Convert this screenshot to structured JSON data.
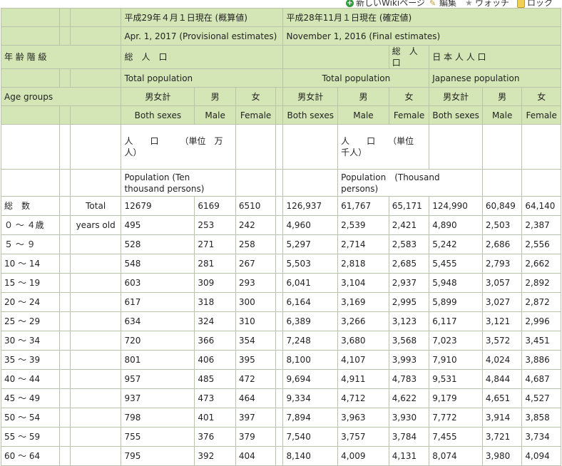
{
  "toolbar": {
    "new_wiki": "新しいWikiページ",
    "edit": "編集",
    "watch": "ウォッチ",
    "lock": "ロック"
  },
  "header": {
    "date_2017_jp": "平成29年４月１日現在 (概算値)",
    "date_2016_jp": "平成28年11月１日現在 (確定値)",
    "date_2017_en": "Apr. 1, 2017 (Provisional estimates)",
    "date_2016_en": "November 1, 2016 (Final estimates)",
    "age_jp": "年 齢 階 級",
    "total_pop_jp": "総　人　口",
    "japanese_pop_jp": "日 本 人 人 口",
    "total_pop_en": "Total population",
    "japanese_pop_en": "Japanese population",
    "age_en": "Age groups",
    "both_jp": "男女計",
    "male_jp": "男",
    "female_jp": "女",
    "both_en": "Both sexes",
    "male_en": "Male",
    "female_en": "Female",
    "unit_2017_jp": "人　　口　　　（単位　万人）",
    "unit_2016_jp": "人　　口　　（単位　千人）",
    "unit_2017_en": "Population (Ten thousand persons)",
    "unit_2016_en": "Population　(Thousand persons)"
  },
  "rows": [
    {
      "age": "総　数",
      "age_en": "Total",
      "v": [
        "12679",
        "6169",
        "6510",
        "126,937",
        "61,767",
        "65,171",
        "124,990",
        "60,849",
        "64,140"
      ]
    },
    {
      "age": "０ ～ ４歳",
      "age_en": "years old",
      "v": [
        "495",
        "253",
        "242",
        "4,960",
        "2,539",
        "2,421",
        "4,890",
        "2,503",
        "2,387"
      ]
    },
    {
      "age": "５ ～ ９",
      "age_en": "",
      "v": [
        "528",
        "271",
        "258",
        "5,297",
        "2,714",
        "2,583",
        "5,242",
        "2,686",
        "2,556"
      ]
    },
    {
      "age": "10 ～ 14",
      "age_en": "",
      "v": [
        "548",
        "281",
        "267",
        "5,503",
        "2,818",
        "2,685",
        "5,455",
        "2,793",
        "2,662"
      ]
    },
    {
      "age": "15 ～ 19",
      "age_en": "",
      "v": [
        "603",
        "309",
        "293",
        "6,041",
        "3,104",
        "2,937",
        "5,948",
        "3,057",
        "2,892"
      ]
    },
    {
      "age": "20 ～ 24",
      "age_en": "",
      "v": [
        "617",
        "318",
        "300",
        "6,164",
        "3,169",
        "2,995",
        "5,899",
        "3,027",
        "2,872"
      ]
    },
    {
      "age": "25 ～ 29",
      "age_en": "",
      "v": [
        "634",
        "324",
        "310",
        "6,389",
        "3,266",
        "3,123",
        "6,117",
        "3,121",
        "2,996"
      ]
    },
    {
      "age": "30 ～ 34",
      "age_en": "",
      "v": [
        "720",
        "366",
        "354",
        "7,248",
        "3,680",
        "3,568",
        "7,023",
        "3,572",
        "3,451"
      ]
    },
    {
      "age": "35 ～ 39",
      "age_en": "",
      "v": [
        "801",
        "406",
        "395",
        "8,100",
        "4,107",
        "3,993",
        "7,910",
        "4,024",
        "3,886"
      ]
    },
    {
      "age": "40 ～ 44",
      "age_en": "",
      "v": [
        "957",
        "485",
        "472",
        "9,694",
        "4,911",
        "4,783",
        "9,531",
        "4,844",
        "4,687"
      ]
    },
    {
      "age": "45 ～ 49",
      "age_en": "",
      "v": [
        "937",
        "473",
        "464",
        "9,334",
        "4,712",
        "4,622",
        "9,179",
        "4,651",
        "4,527"
      ]
    },
    {
      "age": "50 ～ 54",
      "age_en": "",
      "v": [
        "798",
        "401",
        "397",
        "7,894",
        "3,963",
        "3,930",
        "7,772",
        "3,914",
        "3,858"
      ]
    },
    {
      "age": "55 ～ 59",
      "age_en": "",
      "v": [
        "755",
        "376",
        "379",
        "7,540",
        "3,757",
        "3,784",
        "7,455",
        "3,721",
        "3,734"
      ]
    },
    {
      "age": "60 ～ 64",
      "age_en": "",
      "v": [
        "795",
        "392",
        "404",
        "8,140",
        "4,009",
        "4,131",
        "8,074",
        "3,980",
        "4,094"
      ]
    }
  ]
}
